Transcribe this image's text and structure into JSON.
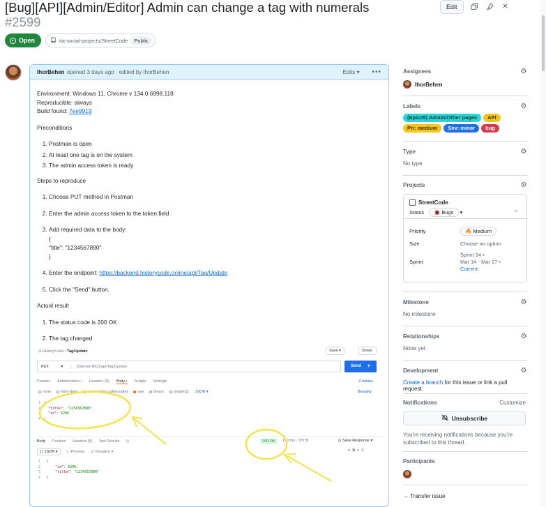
{
  "issue": {
    "title": "[Bug][API][Admin/Editor] Admin can change a tag with numerals",
    "number": "#2599",
    "state": "Open",
    "repo": "ita-social-projects/StreetCode",
    "visibility": "Public",
    "edit_label": "Edit"
  },
  "comment": {
    "author": "IhorBehen",
    "meta": "opened 3 days ago · edited by IhorBehen",
    "edits_label": "Edits",
    "env": "Environment: Windows 11, Chrome v 134.0.6998.118",
    "repro": "Reproducible: always",
    "build_prefix": "Build found: ",
    "build_link": "7ee9919",
    "preconditions_title": "Preconditions",
    "preconditions": [
      "Postman is open",
      "At least one tag is on the system",
      "The admin access token is ready"
    ],
    "steps_title": "Steps to reproduce",
    "steps": {
      "s1": "Choose PUT method in Postman",
      "s2": "Enter the admin access token to the token field",
      "s3": "Add required data to the body:",
      "code_open": "{",
      "code_line": "\"title\": \"1234567890\"",
      "code_close": "}",
      "s4_prefix": "Enter the endpoint: ",
      "s4_link": "https://backend.historycode.online/api/Tag/Update",
      "s5": "Click the \"Send\" button."
    },
    "actual_title": "Actual result",
    "actual": [
      "The status code is 200 OK",
      "The tag changed"
    ]
  },
  "screenshot": {
    "crumb_root": "HistoryCode",
    "crumb_leaf": "Tag/Update",
    "save": "Save",
    "share": "Share",
    "method": "PUT",
    "url": "{{Server-HC}}/api/Tag/Update",
    "send": "Send",
    "tabs": [
      "Params",
      "Authorization •",
      "Headers (9)",
      "Body •",
      "Scripts",
      "Settings"
    ],
    "cookies": "Cookies",
    "body_types": [
      "none",
      "form-data",
      "x-www-form-urlencoded",
      "raw",
      "binary",
      "GraphQL",
      "JSON"
    ],
    "beautify": "Beautify",
    "req_lines": {
      "l1": "{",
      "l2k": "\"title\"",
      "l2v": "\"1234567890\",",
      "l3k": "\"id\"",
      "l3v": "6296",
      "l4": "}"
    },
    "resp_tabs": [
      "Body",
      "Cookies",
      "Headers (5)",
      "Test Results"
    ],
    "status": "200 OK",
    "resp_meta": "153 ms · 337 B",
    "save_response": "Save Response",
    "json_label": "{ } JSON",
    "preview": "Preview",
    "visualize": "Visualize",
    "resp_lines": {
      "l1": "{",
      "l2k": "\"id\"",
      "l2v": "6296,",
      "l3k": "\"title\"",
      "l3v": "\"1234567890\"",
      "l4": "}"
    }
  },
  "sidebar": {
    "assignees_title": "Assignees",
    "assignee": "IhorBehen",
    "labels_title": "Labels",
    "labels": [
      {
        "text": "(Epic#5) Admin/Other pages",
        "bg": "#2dd4d4",
        "fg": "#0d3b3b"
      },
      {
        "text": "API",
        "bg": "#f5c518",
        "fg": "#3d2e00"
      },
      {
        "text": "Pri: medium",
        "bg": "#f5c518",
        "fg": "#3d2e00"
      },
      {
        "text": "Sev: minor",
        "bg": "#1f6feb",
        "fg": "#ffffff"
      },
      {
        "text": "bug",
        "bg": "#d73a4a",
        "fg": "#ffffff"
      }
    ],
    "type_title": "Type",
    "type_value": "No type",
    "projects_title": "Projects",
    "project_name": "StreetCode",
    "status_label": "Status",
    "status_value": "🐞 Bugs",
    "priority_label": "Priority",
    "priority_value": "🔥 Medium",
    "size_label": "Size",
    "size_value": "Choose an option",
    "sprint_label": "Sprint",
    "sprint_line1": "Sprint 24 •",
    "sprint_line2": "Mar 14 - Mar 27 •",
    "sprint_line3": "Current",
    "milestone_title": "Milestone",
    "milestone_value": "No milestone",
    "relationships_title": "Relationships",
    "relationships_value": "None yet",
    "development_title": "Development",
    "dev_link": "Create a branch",
    "dev_text": " for this issue or link a pull request.",
    "notifications_title": "Notifications",
    "customize": "Customize",
    "unsubscribe": "Unsubscribe",
    "notif_text": "You're receiving notifications because you're subscribed to this thread.",
    "participants_title": "Participants",
    "transfer": "Transfer issue"
  },
  "colors": {
    "open": "#1f883d",
    "link": "#0969da",
    "annotation": "#f2e34a"
  }
}
